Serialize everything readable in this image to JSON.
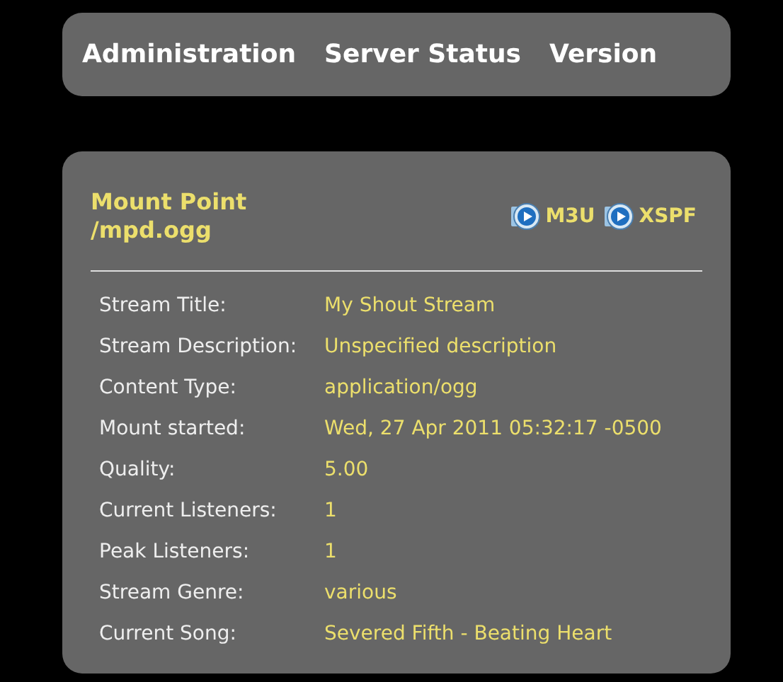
{
  "nav": {
    "links": [
      "Administration",
      "Server Status",
      "Version"
    ]
  },
  "mount": {
    "heading": "Mount Point /mpd.ogg",
    "playlists": [
      "M3U",
      "XSPF"
    ],
    "rows": [
      {
        "label": "Stream Title:",
        "value": "My Shout Stream"
      },
      {
        "label": "Stream Description:",
        "value": "Unspecified description"
      },
      {
        "label": "Content Type:",
        "value": "application/ogg"
      },
      {
        "label": "Mount started:",
        "value": "Wed, 27 Apr 2011 05:32:17 -0500"
      },
      {
        "label": "Quality:",
        "value": "5.00"
      },
      {
        "label": "Current Listeners:",
        "value": "1"
      },
      {
        "label": "Peak Listeners:",
        "value": "1"
      },
      {
        "label": "Stream Genre:",
        "value": "various"
      },
      {
        "label": "Current Song:",
        "value": "Severed Fifth - Beating Heart"
      }
    ]
  }
}
